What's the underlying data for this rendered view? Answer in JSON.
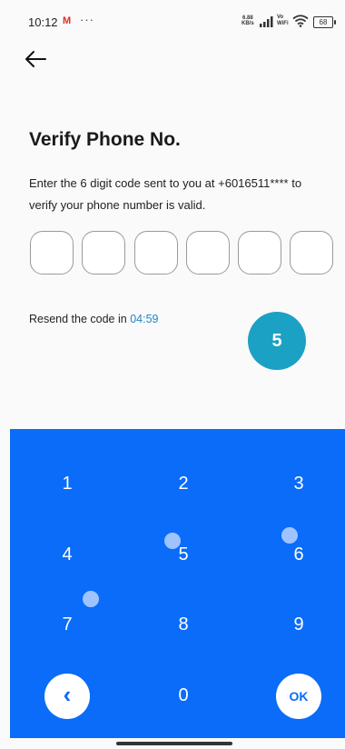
{
  "status_bar": {
    "time": "10:12",
    "app_icon": "M",
    "more": "···",
    "net_speed_value": "6.88",
    "net_speed_unit": "KB/s",
    "volte_top": "Vo",
    "volte_bottom": "WiFi",
    "battery": "68"
  },
  "page": {
    "title": "Verify Phone No.",
    "description": "Enter the 6 digit code sent to you at +6016511**** to verify your phone number is valid.",
    "resend_label": "Resend the code in",
    "resend_timer": "04:59",
    "step_badge": "5",
    "code_fields": [
      "",
      "",
      "",
      "",
      "",
      ""
    ]
  },
  "keypad": {
    "keys": [
      "1",
      "2",
      "3",
      "4",
      "5",
      "6",
      "7",
      "8",
      "9",
      "0"
    ],
    "back_symbol": "‹",
    "ok_label": "OK"
  },
  "colors": {
    "keypad_bg": "#0a6cf8",
    "badge_bg": "#1ba1c4",
    "timer": "#1e88c8"
  }
}
